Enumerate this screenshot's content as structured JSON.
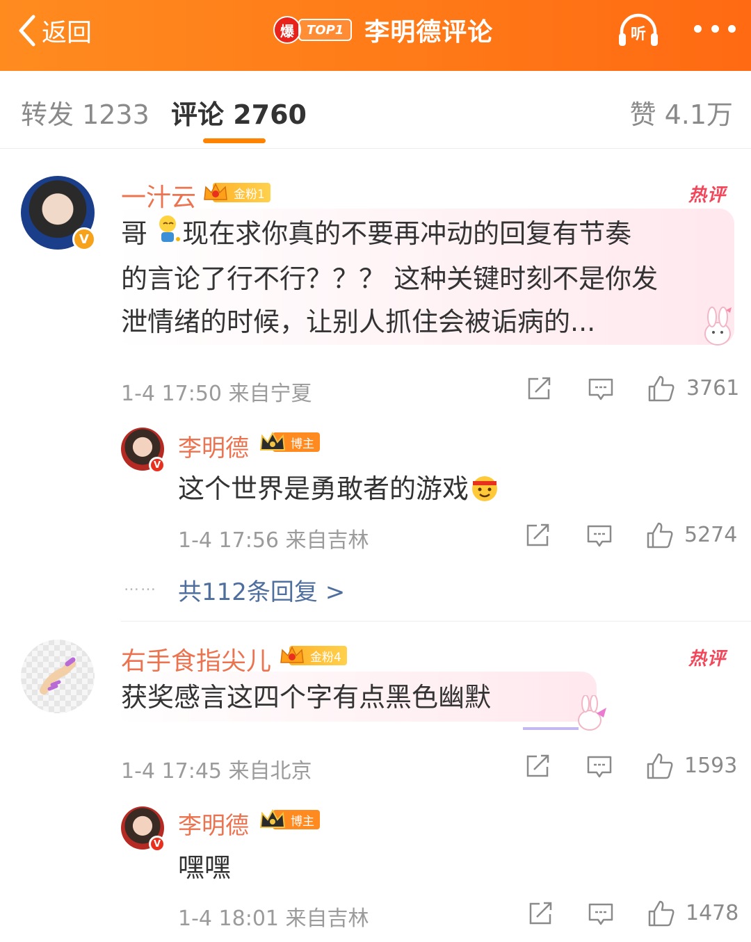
{
  "header": {
    "back_label": "返回",
    "hot_logo": "爆",
    "rank_label": "TOP1",
    "title": "李明德评论",
    "listen_label": "听",
    "bg_color": "#ff7a18"
  },
  "tabs": [
    {
      "label": "转发 1233"
    },
    {
      "label": "评论 2760"
    },
    {
      "label": "赞 4.1万"
    }
  ],
  "hot_label": "热评",
  "comments": [
    {
      "user": "一汁云",
      "fan_badge": "金粉1",
      "text": "哥 🙇现在求你真的不要再冲动的回复有节奏的言论了行不行？？？ 这种关键时刻不是你发泄情绪的时候，让别人抓住会被诟病的...",
      "text_parts": [
        "哥 ",
        "现在求你真的不要再冲动的回复有节奏",
        "的言论了行不行？？？ 这种关键时刻不是你发",
        "泄情绪的时候，让别人抓住会被诟病的..."
      ],
      "time_location": "1-4 17:50  来自宁夏",
      "likes": "3761",
      "reply": {
        "user": "李明德",
        "role_badge": "博主",
        "text": "这个世界是勇敢者的游戏",
        "time_location": "1-4 17:56  来自吉林",
        "likes": "5274"
      },
      "more_replies": "共112条回复 >"
    },
    {
      "user": "右手食指尖儿",
      "fan_badge": "金粉4",
      "text": "获奖感言这四个字有点黑色幽默",
      "time_location": "1-4 17:45  来自北京",
      "likes": "1593",
      "reply": {
        "user": "李明德",
        "role_badge": "博主",
        "text": "嘿嘿",
        "time_location": "1-4 18:01  来自吉林",
        "likes": "1478"
      }
    }
  ],
  "icons": [
    "back-chevron-icon",
    "headphones-icon",
    "more-dots-icon",
    "share-icon",
    "comment-icon",
    "like-icon",
    "verified-icon",
    "crown-icon"
  ]
}
